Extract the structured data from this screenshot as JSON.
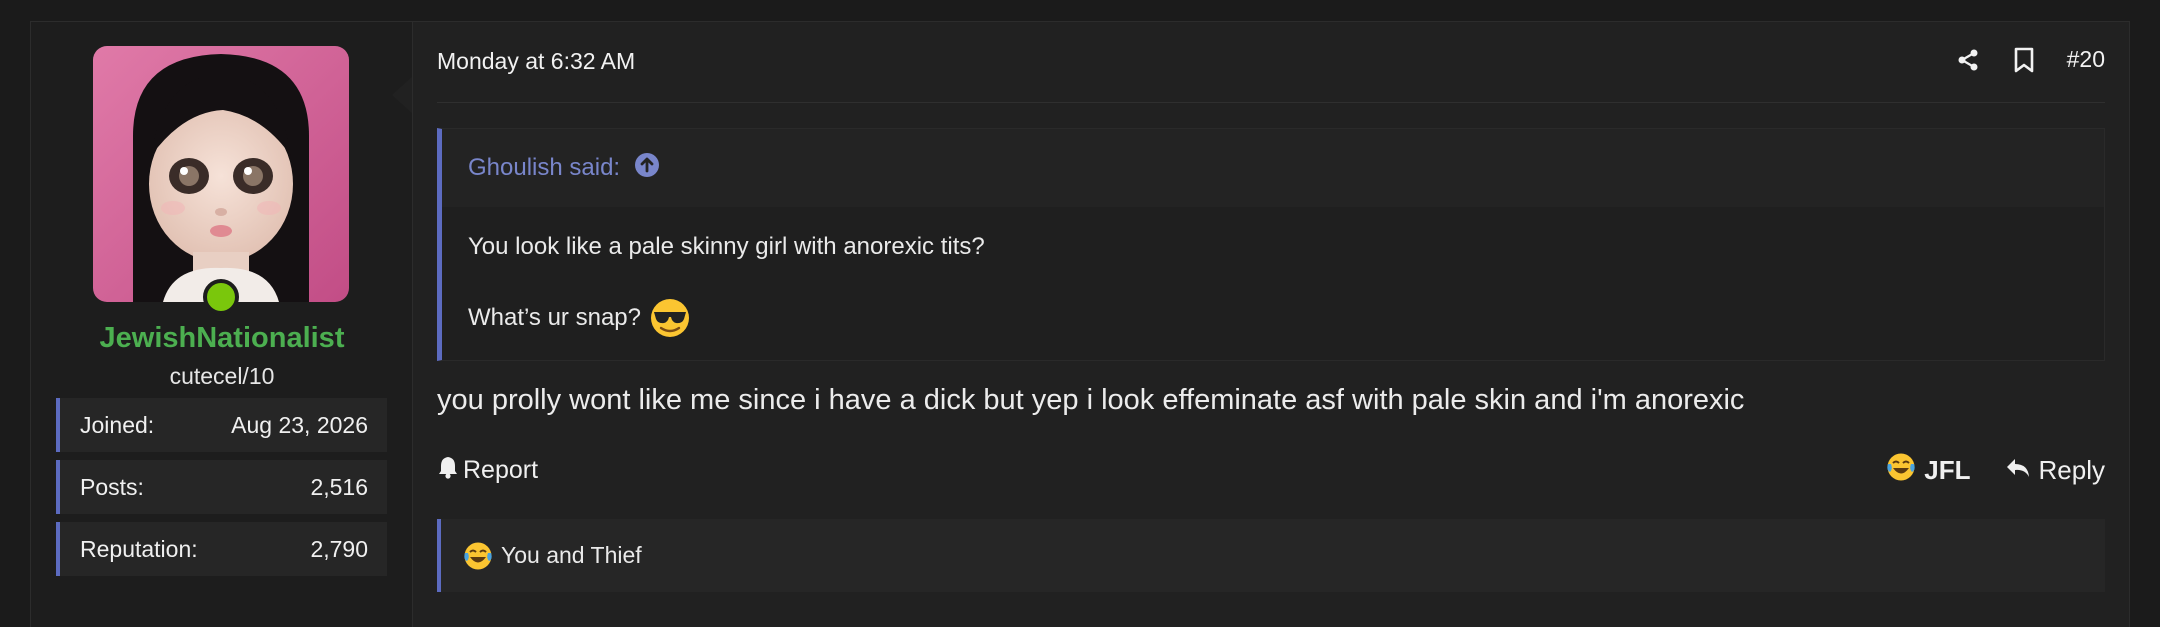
{
  "user": {
    "username": "JewishNationalist",
    "title": "cutecel/10",
    "stats": [
      {
        "label": "Joined:",
        "value": "Aug 23, 2026"
      },
      {
        "label": "Posts:",
        "value": "2,516"
      },
      {
        "label": "Reputation:",
        "value": "2,790"
      }
    ],
    "online": true
  },
  "post": {
    "date": "Monday at 6:32 AM",
    "number": "#20",
    "quote": {
      "author_label": "Ghoulish said:",
      "line1": "You look like a pale skinny girl with anorexic tits?",
      "line2": "What’s ur snap?"
    },
    "body": "you prolly wont like me since i have a dick but yep i look effeminate asf with pale skin and i'm anorexic",
    "report_label": "Report",
    "reaction_label": "JFL",
    "reply_label": "Reply",
    "reactions_summary": "You and Thief"
  },
  "colors": {
    "accent": "#5c6bc0",
    "username": "#4caf50",
    "online": "#7ac70c",
    "quote_link": "#7986cb"
  },
  "icons": [
    "share-icon",
    "bookmark-icon",
    "arrow-up-circle-icon",
    "bell-icon",
    "crying-laughing-emoji",
    "reply-arrow-icon",
    "sunglasses-emoji"
  ]
}
